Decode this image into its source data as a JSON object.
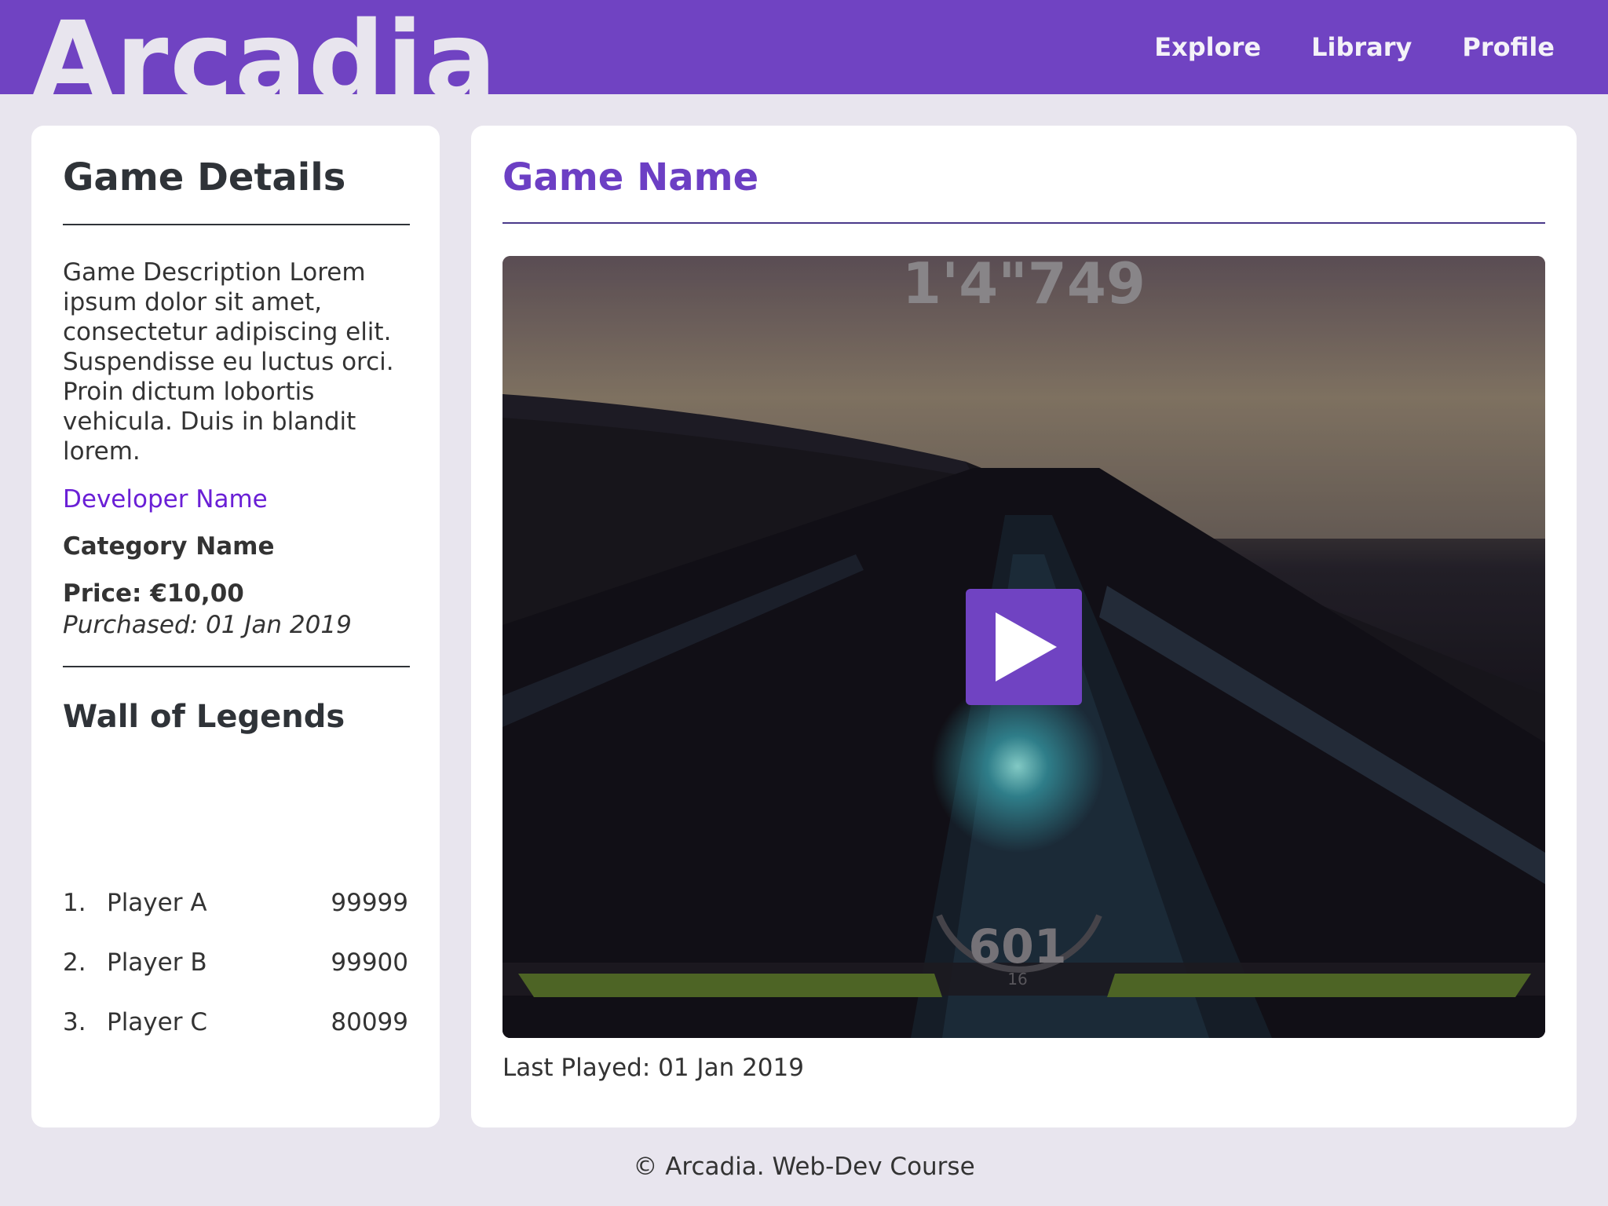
{
  "header": {
    "logo": "Arcadia",
    "nav": [
      "Explore",
      "Library",
      "Profile"
    ],
    "color": "#7043c2"
  },
  "details": {
    "title": "Game Details",
    "description": "Game Description Lorem ipsum dolor sit amet, consectetur adipiscing elit. Suspendisse eu luctus orci. Proin dictum lobortis vehicula. Duis in blandit lorem.",
    "developer": "Developer Name",
    "category": "Category Name",
    "price": "Price: €10,00",
    "purchased": "Purchased: 01 Jan 2019"
  },
  "legends": {
    "title": "Wall of Legends",
    "rows": [
      {
        "rank": "1.",
        "player": "Player A",
        "score": "99999"
      },
      {
        "rank": "2.",
        "player": "Player B",
        "score": "99900"
      },
      {
        "rank": "3.",
        "player": "Player C",
        "score": "80099"
      }
    ]
  },
  "main": {
    "title": "Game Name",
    "video": {
      "hud_time": "1'4\"749",
      "hud_speed": "601",
      "hud_sub": "16"
    },
    "last_played": "Last Played: 01 Jan 2019"
  },
  "footer": "© Arcadia. Web-Dev Course"
}
